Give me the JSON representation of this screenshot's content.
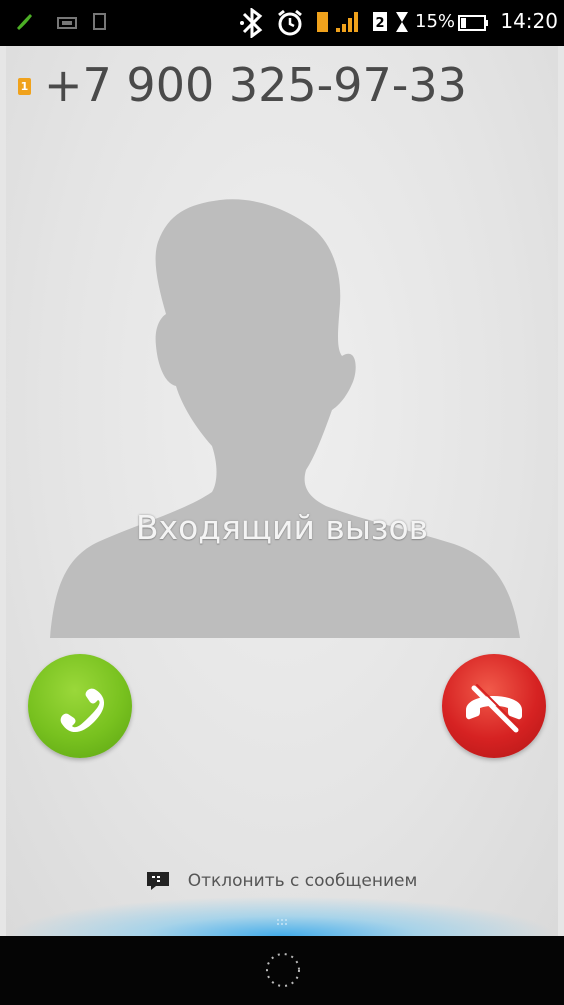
{
  "status_bar": {
    "icons": [
      "call-icon",
      "voicemail-icon",
      "sim-icon",
      "bluetooth-icon",
      "alarm-icon",
      "sim-card-icon",
      "signal-icon",
      "sim2-icon",
      "hourglass-icon",
      "battery-icon"
    ],
    "battery_percent": "15%",
    "clock": "14:20"
  },
  "caller": {
    "sim_badge": "1",
    "phone_number": "+7 900 325-97-33",
    "avatar": "person-silhouette"
  },
  "call": {
    "status_label": "Входящий вызов",
    "answer_icon": "phone-icon",
    "decline_icon": "hang-up-icon",
    "answer_color": "#78c11f",
    "decline_color": "#d62222"
  },
  "decline_with_message": {
    "label": "Отклонить с сообщением",
    "icon": "message-icon"
  },
  "nav_bar": {
    "icon": "home-ring-icon"
  }
}
